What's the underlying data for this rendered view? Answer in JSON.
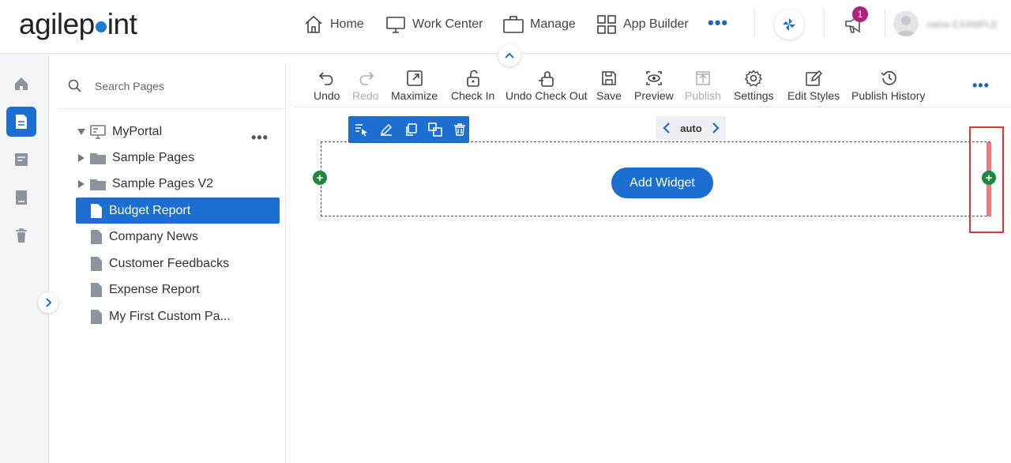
{
  "brand": {
    "logo_prefix": "agilep",
    "logo_suffix": "int"
  },
  "nav": {
    "items": [
      {
        "label": "Home",
        "icon": "home-icon"
      },
      {
        "label": "Work Center",
        "icon": "monitor-icon"
      },
      {
        "label": "Manage",
        "icon": "briefcase-icon"
      },
      {
        "label": "App Builder",
        "icon": "grid-icon"
      }
    ],
    "more": "•••",
    "notification_count": "1",
    "username": "name EXAMPLE"
  },
  "rail": {
    "items": [
      "home-icon",
      "page-icon",
      "form-icon",
      "book-icon",
      "trash-icon"
    ],
    "active_index": 1
  },
  "tree": {
    "search_placeholder": "Search Pages",
    "root": "MyPortal",
    "more": "•••",
    "items": [
      {
        "label": "Sample Pages",
        "type": "folder"
      },
      {
        "label": "Sample Pages V2",
        "type": "folder"
      },
      {
        "label": "Budget Report",
        "type": "page",
        "selected": true
      },
      {
        "label": "Company News",
        "type": "page"
      },
      {
        "label": "Customer Feedbacks",
        "type": "page"
      },
      {
        "label": "Expense Report",
        "type": "page"
      },
      {
        "label": "My First Custom Pa...",
        "type": "page"
      }
    ]
  },
  "toolbar": {
    "undo": "Undo",
    "redo": "Redo",
    "maximize": "Maximize",
    "check_in": "Check In",
    "undo_check_out": "Undo Check Out",
    "save": "Save",
    "preview": "Preview",
    "publish": "Publish",
    "settings": "Settings",
    "edit_styles": "Edit Styles",
    "publish_history": "Publish History",
    "more": "•••"
  },
  "canvas": {
    "column_width": "auto",
    "add_widget": "Add Widget",
    "plus": "+"
  },
  "colors": {
    "accent": "#1c6fd1",
    "add_green": "#1b8a3b",
    "highlight_red": "#d63a3a",
    "badge": "#b0217a"
  }
}
